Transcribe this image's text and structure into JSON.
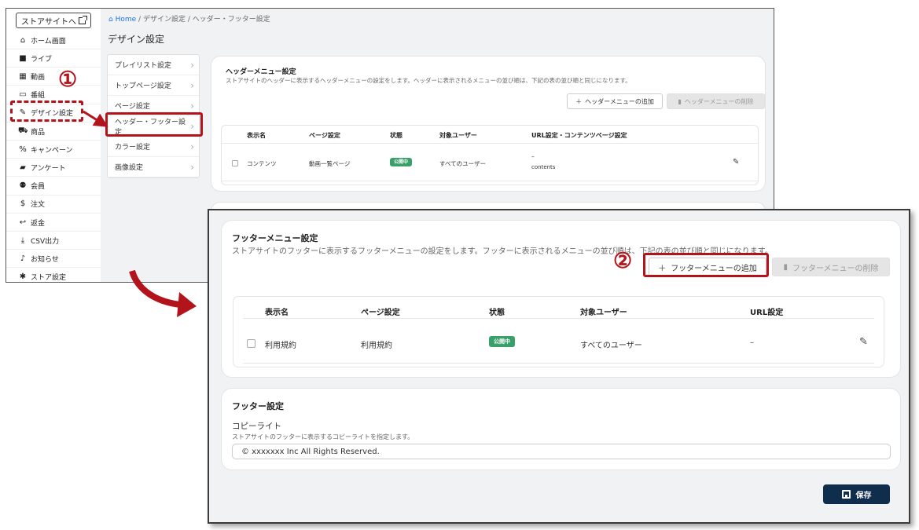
{
  "sidebar": {
    "store_link": "ストアサイトへ",
    "items": [
      {
        "label": "ホーム画面",
        "icon": "home-icon",
        "glyph": "⌂"
      },
      {
        "label": "ライブ",
        "icon": "video-camera-icon",
        "glyph": "■"
      },
      {
        "label": "動画",
        "icon": "movie-clapper-icon",
        "glyph": "▦"
      },
      {
        "label": "番組",
        "icon": "tv-icon",
        "glyph": "▭"
      },
      {
        "label": "デザイン設定",
        "icon": "brush-icon",
        "glyph": "✎"
      },
      {
        "label": "商品",
        "icon": "cart-icon",
        "glyph": "⛟"
      },
      {
        "label": "キャンペーン",
        "icon": "percent-icon",
        "glyph": "%"
      },
      {
        "label": "アンケート",
        "icon": "chat-icon",
        "glyph": "▰"
      },
      {
        "label": "会員",
        "icon": "people-icon",
        "glyph": "⚉"
      },
      {
        "label": "注文",
        "icon": "dollar-icon",
        "glyph": "$"
      },
      {
        "label": "返金",
        "icon": "return-arrow-icon",
        "glyph": "↩"
      },
      {
        "label": "CSV出力",
        "icon": "download-icon",
        "glyph": "⤓"
      },
      {
        "label": "お知らせ",
        "icon": "bell-icon",
        "glyph": "♪"
      },
      {
        "label": "ストア設定",
        "icon": "gear-icon",
        "glyph": "✱"
      }
    ]
  },
  "breadcrumb": {
    "home": "Home",
    "sep": "/",
    "level1": "デザイン設定",
    "level2": "ヘッダー・フッター設定"
  },
  "page_title": "デザイン設定",
  "submenu": [
    "プレイリスト設定",
    "トップページ設定",
    "ページ設定",
    "ヘッダー・フッター設定",
    "カラー設定",
    "画像設定"
  ],
  "header_menu": {
    "title": "ヘッダーメニュー設定",
    "desc": "ストアサイトのヘッダーに表示するヘッダーメニューの設定をします。ヘッダーに表示されるメニューの並び順は、下記の表の並び順と同じになります。",
    "add_button": "ヘッダーメニューの追加",
    "delete_button": "ヘッダーメニューの削除",
    "columns": [
      "表示名",
      "ページ設定",
      "状態",
      "対象ユーザー",
      "URL設定・コンテンツページ設定"
    ],
    "row": {
      "name": "コンテンツ",
      "page": "動画一覧ページ",
      "status": "公開中",
      "target": "すべてのユーザー",
      "url_dash": "–",
      "url_sub": "contents"
    }
  },
  "footer_menu": {
    "title": "フッターメニュー設定",
    "desc": "ストアサイトのフッターに表示するフッターメニューの設定をします。フッターに表示されるメニューの並び順は、下記の表の並び順と同じになります。",
    "add_button": "フッターメニューの追加",
    "delete_button": "フッターメニューの削除",
    "columns": [
      "表示名",
      "ページ設定",
      "状態",
      "対象ユーザー",
      "URL設定"
    ],
    "row": {
      "name": "利用規約",
      "page": "利用規約",
      "status": "公開中",
      "target": "すべてのユーザー",
      "url": "–"
    }
  },
  "footer_settings": {
    "title": "フッター設定",
    "copyright_label": "コピーライト",
    "copyright_desc": "ストアサイトのフッターに表示するコピーライトを指定します。",
    "copyright_value": "© xxxxxxx Inc All Rights Reserved."
  },
  "save_button": "保存",
  "annotations": {
    "step1": "①",
    "step2": "②",
    "color": "#b3141b"
  },
  "colors": {
    "accent_dark": "#0f2d4d",
    "badge_green": "#3aa06a",
    "link_blue": "#1a73e8"
  }
}
